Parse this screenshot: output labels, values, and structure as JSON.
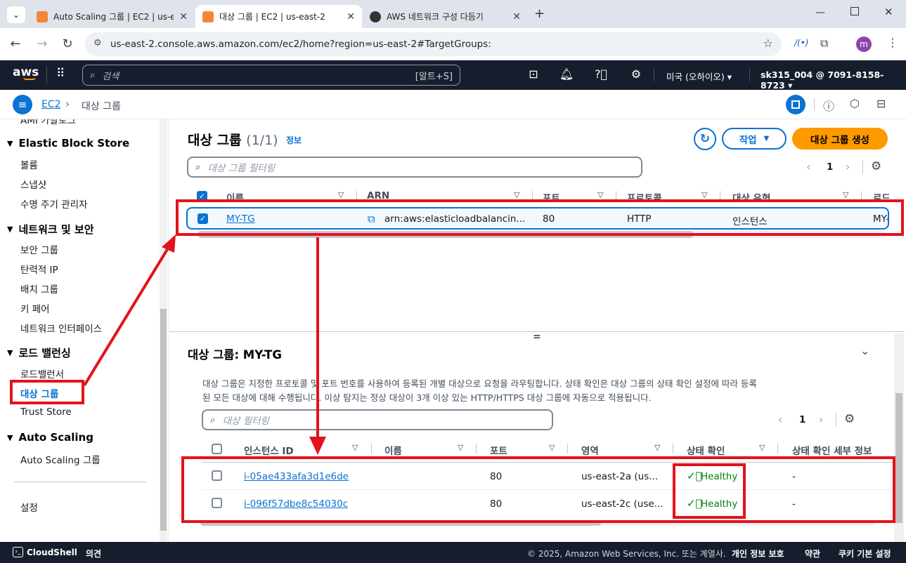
{
  "browser": {
    "tabs": [
      {
        "title": "Auto Scaling 그룹 | EC2 | us-e",
        "active": false
      },
      {
        "title": "대상 그룹 | EC2 | us-east-2",
        "active": true
      },
      {
        "title": "AWS 네트워크 구성 다듬기",
        "active": false
      }
    ],
    "url": "us-east-2.console.aws.amazon.com/ec2/home?region=us-east-2#TargetGroups:",
    "profile_initial": "m"
  },
  "awsnav": {
    "logo": "aws",
    "search_placeholder": "검색",
    "search_shortcut": "[알트+S]",
    "region": "미국 (오하이오)",
    "account": "sk315_004 @ 7091-8158-8723"
  },
  "breadcrumb": {
    "root": "EC2",
    "current": "대상 그룹"
  },
  "sidebar": {
    "top_cut": "AMI 카탈로그",
    "sections": [
      {
        "title": "Elastic Block Store",
        "items": [
          "볼륨",
          "스냅샷",
          "수명 주기 관리자"
        ]
      },
      {
        "title": "네트워크 및 보안",
        "items": [
          "보안 그룹",
          "탄력적 IP",
          "배치 그룹",
          "키 페어",
          "네트워크 인터페이스"
        ]
      },
      {
        "title": "로드 밸런싱",
        "items": [
          "로드밸런서",
          "대상 그룹",
          "Trust Store"
        ]
      },
      {
        "title": "Auto Scaling",
        "items": [
          "Auto Scaling 그룹"
        ]
      }
    ],
    "settings": "설정"
  },
  "main": {
    "title": "대상 그룹",
    "count": "(1/1)",
    "info": "정보",
    "actions_label": "작업",
    "create_label": "대상 그룹 생성",
    "filter_placeholder": "대상 그룹 필터링",
    "page": "1",
    "columns": [
      "이름",
      "ARN",
      "포트",
      "프로토콜",
      "대상 유형",
      "로드"
    ],
    "rows": [
      {
        "name": "MY-TG",
        "arn": "arn:aws:elasticloadbalancin...",
        "port": "80",
        "protocol": "HTTP",
        "target_type": "인스턴스",
        "lb": "MY-"
      }
    ]
  },
  "detail": {
    "title": "대상 그룹: MY-TG",
    "description_1": "대상 그룹은 지정한 프로토콜 및 포트 번호를 사용하여 등록된 개별 대상으로 요청을 라우팅합니다. 상태 확인은 대상 그룹의 상태 확인 설정에 따라 등록",
    "description_2": "된 모든 대상에 대해 수행됩니다. 이상 탐지는 정상 대상이 3개 이상 있는 HTTP/HTTPS 대상 그룹에 자동으로 적용됩니다.",
    "filter_placeholder": "대상 필터링",
    "page": "1",
    "columns": [
      "인스턴스 ID",
      "이름",
      "포트",
      "영역",
      "상태 확인",
      "상태 확인 세부 정보"
    ],
    "rows": [
      {
        "id": "i-05ae433afa3d1e6de",
        "name": "",
        "port": "80",
        "zone": "us-east-2a (us...",
        "health": "Healthy",
        "details": "-"
      },
      {
        "id": "i-096f57dbe8c54030c",
        "name": "",
        "port": "80",
        "zone": "us-east-2c (use...",
        "health": "Healthy",
        "details": "-"
      }
    ]
  },
  "footer": {
    "cloudshell": "CloudShell",
    "feedback": "의견",
    "copyright": "© 2025, Amazon Web Services, Inc. 또는 계열사.",
    "privacy": "개인 정보 보호",
    "terms": "약관",
    "cookies": "쿠키 기본 설정"
  },
  "colors": {
    "accent": "#0972d3",
    "orange": "#ff9900",
    "annotation_red": "#e3131b",
    "healthy": "#037f0c",
    "nav_bg": "#161e2d"
  }
}
